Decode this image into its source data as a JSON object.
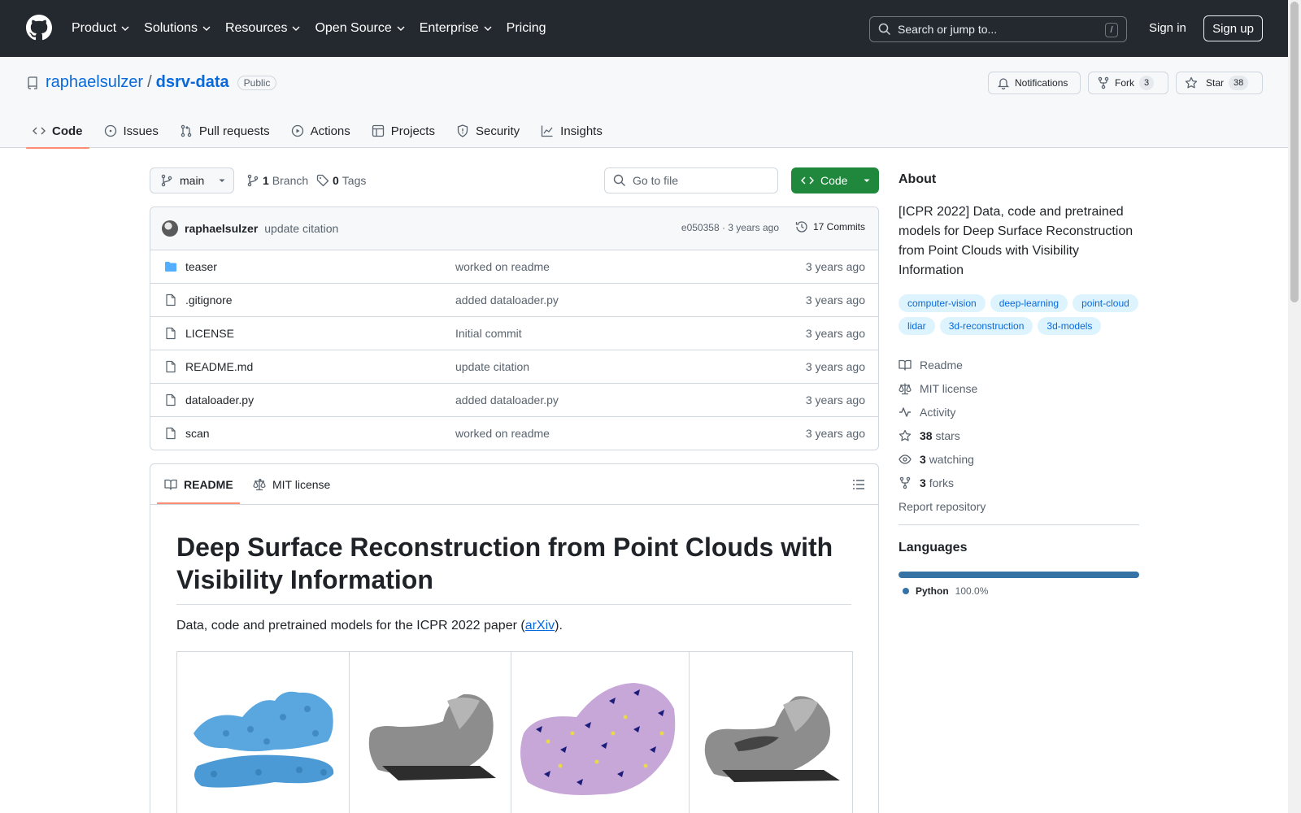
{
  "header": {
    "nav": [
      "Product",
      "Solutions",
      "Resources",
      "Open Source",
      "Enterprise",
      "Pricing"
    ],
    "search_placeholder": "Search or jump to...",
    "search_shortcut": "/",
    "signin": "Sign in",
    "signup": "Sign up"
  },
  "repo": {
    "owner": "raphaelsulzer",
    "separator": "/",
    "name": "dsrv-data",
    "visibility": "Public",
    "notifications_label": "Notifications",
    "fork_label": "Fork",
    "fork_count": "3",
    "star_label": "Star",
    "star_count": "38"
  },
  "tabs": [
    "Code",
    "Issues",
    "Pull requests",
    "Actions",
    "Projects",
    "Security",
    "Insights"
  ],
  "toolbar": {
    "branch": "main",
    "branch_count": "1",
    "branch_label": "Branch",
    "tag_count": "0",
    "tag_label": "Tags",
    "goto_placeholder": "Go to file",
    "code_label": "Code"
  },
  "last_commit": {
    "author": "raphaelsulzer",
    "message": "update citation",
    "meta": "e050358 · 3 years ago",
    "commits_label": "17 Commits"
  },
  "files": [
    {
      "name": "teaser",
      "type": "folder",
      "commit": "worked on readme",
      "time": "3 years ago"
    },
    {
      "name": ".gitignore",
      "type": "file",
      "commit": "added dataloader.py",
      "time": "3 years ago"
    },
    {
      "name": "LICENSE",
      "type": "file",
      "commit": "Initial commit",
      "time": "3 years ago"
    },
    {
      "name": "README.md",
      "type": "file",
      "commit": "update citation",
      "time": "3 years ago"
    },
    {
      "name": "dataloader.py",
      "type": "file",
      "commit": "added dataloader.py",
      "time": "3 years ago"
    },
    {
      "name": "scan",
      "type": "file",
      "commit": "worked on readme",
      "time": "3 years ago"
    }
  ],
  "readme": {
    "tab_readme": "README",
    "tab_license": "MIT license",
    "title": "Deep Surface Reconstruction from Point Clouds with Visibility Information",
    "intro_before": "Data, code and pretrained models for the ICPR 2022 paper (",
    "intro_link": "arXiv",
    "intro_after": ")."
  },
  "about": {
    "heading": "About",
    "description": "[ICPR 2022] Data, code and pretrained models for Deep Surface Reconstruction from Point Clouds with Visibility Information",
    "topics": [
      "computer-vision",
      "deep-learning",
      "point-cloud",
      "lidar",
      "3d-reconstruction",
      "3d-models"
    ],
    "readme": "Readme",
    "license": "MIT license",
    "activity": "Activity",
    "stars_count": "38",
    "stars_label": "stars",
    "watching_count": "3",
    "watching_label": "watching",
    "forks_count": "3",
    "forks_label": "forks",
    "report": "Report repository"
  },
  "languages": {
    "heading": "Languages",
    "name": "Python",
    "percent": "100.0%",
    "color": "#3572A5"
  }
}
